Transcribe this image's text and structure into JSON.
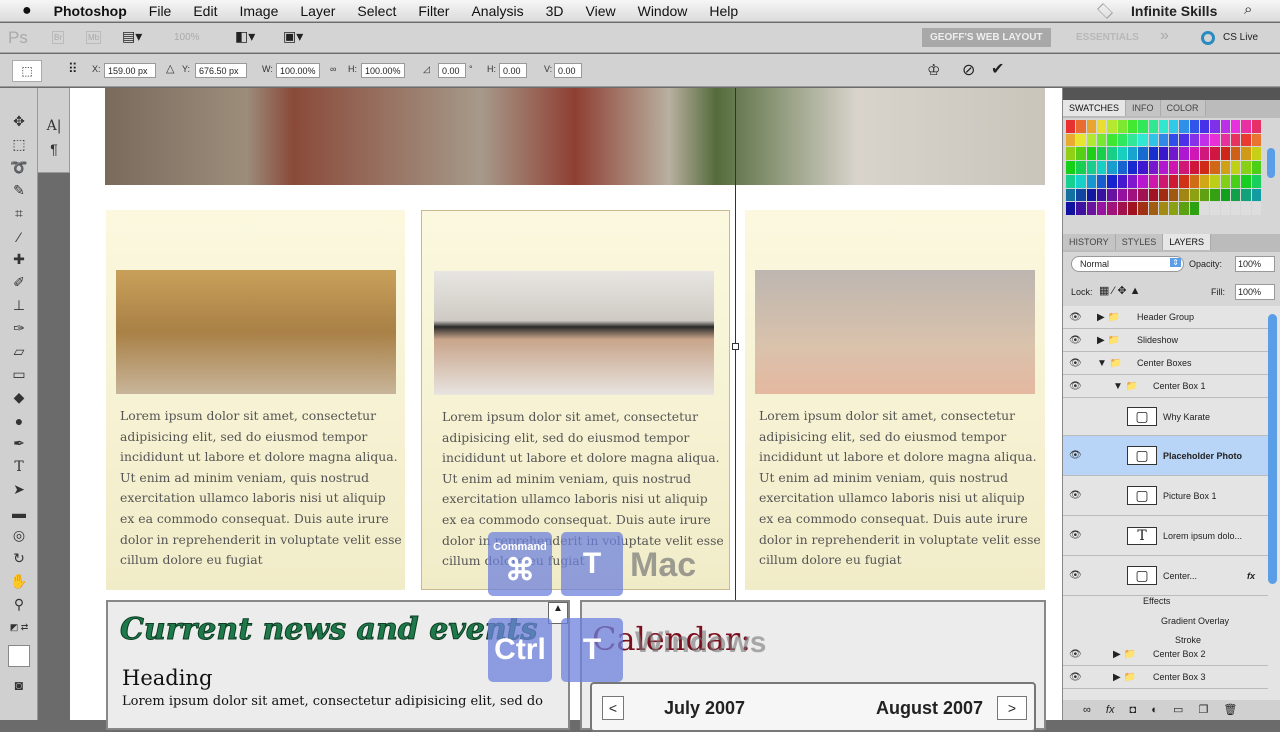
{
  "menubar": {
    "app": "Photoshop",
    "items": [
      "File",
      "Edit",
      "Image",
      "Layer",
      "Select",
      "Filter",
      "Analysis",
      "3D",
      "View",
      "Window",
      "Help"
    ],
    "user": "Infinite Skills"
  },
  "appbar": {
    "ps": "Ps",
    "br": "Br",
    "mb": "Mb",
    "zoom": "100%",
    "workspace_active": "GEOFF'S WEB LAYOUT",
    "workspace_other": "ESSENTIALS",
    "more": "»",
    "cs_live": "CS Live"
  },
  "options": {
    "x_label": "X:",
    "x": "159.00 px",
    "y_label": "Y:",
    "y": "676.50 px",
    "w_label": "W:",
    "w": "100.00%",
    "h_label": "H:",
    "h": "100.00%",
    "angle": "0.00",
    "deg": "°",
    "hskew_label": "H:",
    "hskew": "0.00",
    "vskew_label": "V:",
    "vskew": "0.00"
  },
  "canvas": {
    "paragraph": "Lorem ipsum dolor sit amet, consectetur adipisicing elit, sed do eiusmod tempor incididunt ut labore et dolore magna aliqua. Ut enim ad minim veniam, quis nostrud exercitation ullamco laboris nisi ut aliquip ex ea commodo consequat. Duis aute irure dolor in reprehenderit in voluptate velit esse cillum dolore eu fugiat",
    "news_title": "Current news and events",
    "heading": "Heading",
    "news_text": "Lorem ipsum dolor sit amet, consectetur adipisicing elit, sed do",
    "calendar_title": "Calendar:",
    "month1": "July 2007",
    "month2": "August 2007",
    "prev": "<",
    "next": ">"
  },
  "keys": {
    "mac_mod": "Command",
    "mac_sym": "⌘",
    "mac_key": "T",
    "mac_label": "Mac",
    "win_mod": "Ctrl",
    "win_key": "T",
    "win_label": "Windows"
  },
  "panel": {
    "top_tabs": [
      "SWATCHES",
      "INFO",
      "COLOR"
    ],
    "tabs": [
      "HISTORY",
      "STYLES",
      "LAYERS"
    ],
    "blend": "Normal",
    "opacity_label": "Opacity:",
    "opacity": "100%",
    "lock_label": "Lock:",
    "fill_label": "Fill:",
    "fill": "100%",
    "layers": [
      {
        "name": "Header Group",
        "type": "group"
      },
      {
        "name": "Slideshow",
        "type": "group"
      },
      {
        "name": "Center Boxes",
        "type": "group-open"
      },
      {
        "name": "Center Box 1",
        "type": "group-open"
      },
      {
        "name": "Why Karate",
        "type": "smart"
      },
      {
        "name": "Placeholder Photo",
        "type": "smart",
        "selected": true
      },
      {
        "name": "Picture Box 1",
        "type": "shape"
      },
      {
        "name": "Lorem ipsum dolo...",
        "type": "text"
      },
      {
        "name": "Center...",
        "type": "shape"
      },
      {
        "name": "Center Box 2",
        "type": "group"
      },
      {
        "name": "Center Box 3",
        "type": "group"
      }
    ],
    "effects": "Effects",
    "effect_items": [
      "Gradient Overlay",
      "Stroke"
    ],
    "fx": "fx"
  }
}
